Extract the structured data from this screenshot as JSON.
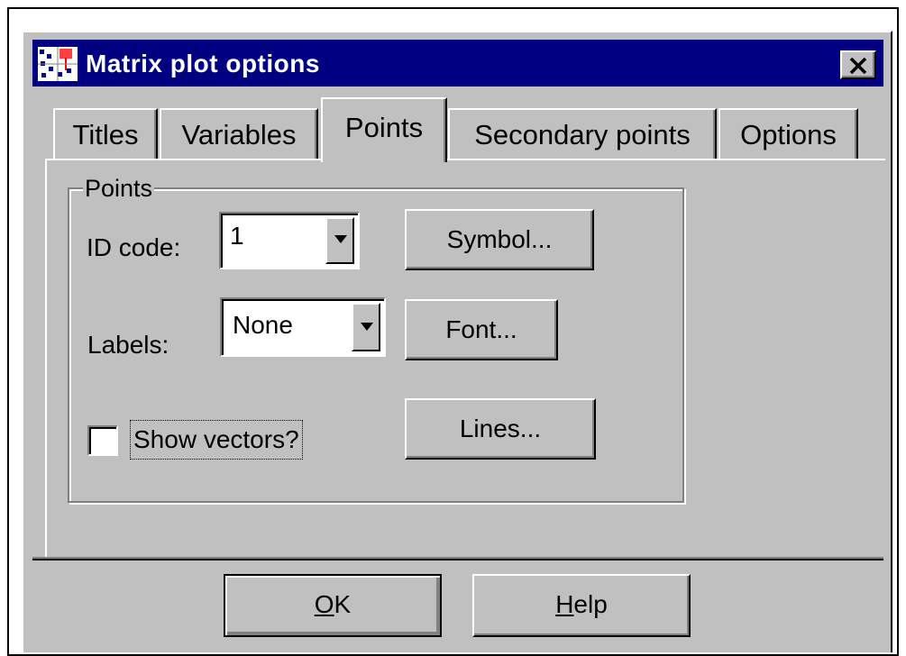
{
  "window": {
    "title": "Matrix plot options",
    "icon": "matrix-plot-app-icon",
    "close_icon": "close-x-icon"
  },
  "tabs": [
    {
      "label": "Titles",
      "active": false
    },
    {
      "label": "Variables",
      "active": false
    },
    {
      "label": "Points",
      "active": true
    },
    {
      "label": "Secondary points",
      "active": false
    },
    {
      "label": "Options",
      "active": false
    }
  ],
  "points_group": {
    "label": "Points",
    "id_code": {
      "label": "ID code:",
      "value": "1"
    },
    "labels": {
      "label": "Labels:",
      "value": "None"
    },
    "show_vectors": {
      "label": "Show vectors?",
      "checked": false
    },
    "buttons": {
      "symbol": "Symbol...",
      "font": "Font...",
      "lines": "Lines..."
    }
  },
  "footer": {
    "ok": {
      "underline": "O",
      "rest": "K"
    },
    "help": {
      "underline": "H",
      "rest": "elp"
    }
  },
  "colors": {
    "titlebar": "#000080",
    "face": "#c0c0c0"
  }
}
